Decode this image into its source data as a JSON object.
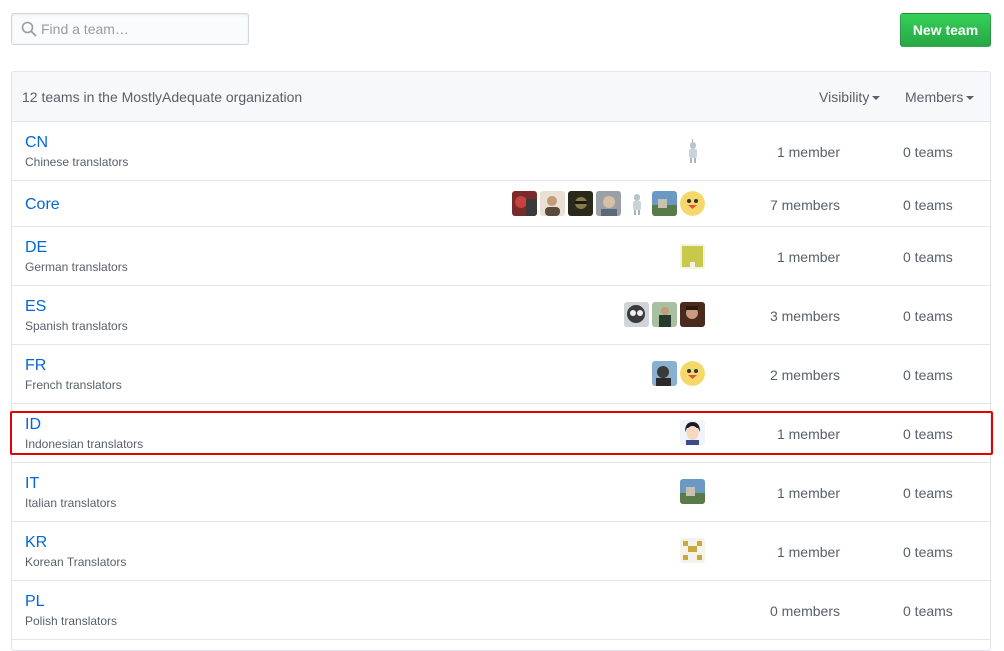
{
  "search": {
    "placeholder": "Find a team…",
    "value": ""
  },
  "toolbar": {
    "new_team_label": "New team"
  },
  "header": {
    "summary": "12 teams in the MostlyAdequate organization",
    "visibility_label": "Visibility",
    "members_label": "Members"
  },
  "teams": [
    {
      "name": "CN",
      "description": "Chinese translators",
      "members": "1 member",
      "teams": "0 teams",
      "avatars": [
        "robot-avatar"
      ]
    },
    {
      "name": "Core",
      "description": "",
      "members": "7 members",
      "teams": "0 teams",
      "avatars": [
        "red-photo-avatar",
        "man-photo-avatar",
        "dark-photo-avatar",
        "gray-photo-avatar",
        "robot-avatar",
        "landscape-avatar",
        "yellow-bird-avatar"
      ]
    },
    {
      "name": "DE",
      "description": "German translators",
      "members": "1 member",
      "teams": "0 teams",
      "avatars": [
        "olive-identicon-avatar"
      ]
    },
    {
      "name": "ES",
      "description": "Spanish translators",
      "members": "3 members",
      "teams": "0 teams",
      "avatars": [
        "cartoon-avatar",
        "outdoor-photo-avatar",
        "man-photo-avatar"
      ]
    },
    {
      "name": "FR",
      "description": "French translators",
      "members": "2 members",
      "teams": "0 teams",
      "avatars": [
        "blue-photo-avatar",
        "yellow-bird-avatar"
      ]
    },
    {
      "name": "ID",
      "description": "Indonesian translators",
      "members": "1 member",
      "teams": "0 teams",
      "avatars": [
        "anime-avatar"
      ]
    },
    {
      "name": "IT",
      "description": "Italian translators",
      "members": "1 member",
      "teams": "0 teams",
      "avatars": [
        "landscape-avatar"
      ]
    },
    {
      "name": "KR",
      "description": "Korean Translators",
      "members": "1 member",
      "teams": "0 teams",
      "avatars": [
        "gold-identicon-avatar"
      ]
    },
    {
      "name": "PL",
      "description": "Polish translators",
      "members": "0 members",
      "teams": "0 teams",
      "avatars": []
    }
  ],
  "colors": {
    "link": "#0366d6",
    "button_green": "#28a745",
    "highlight": "#e60000"
  }
}
